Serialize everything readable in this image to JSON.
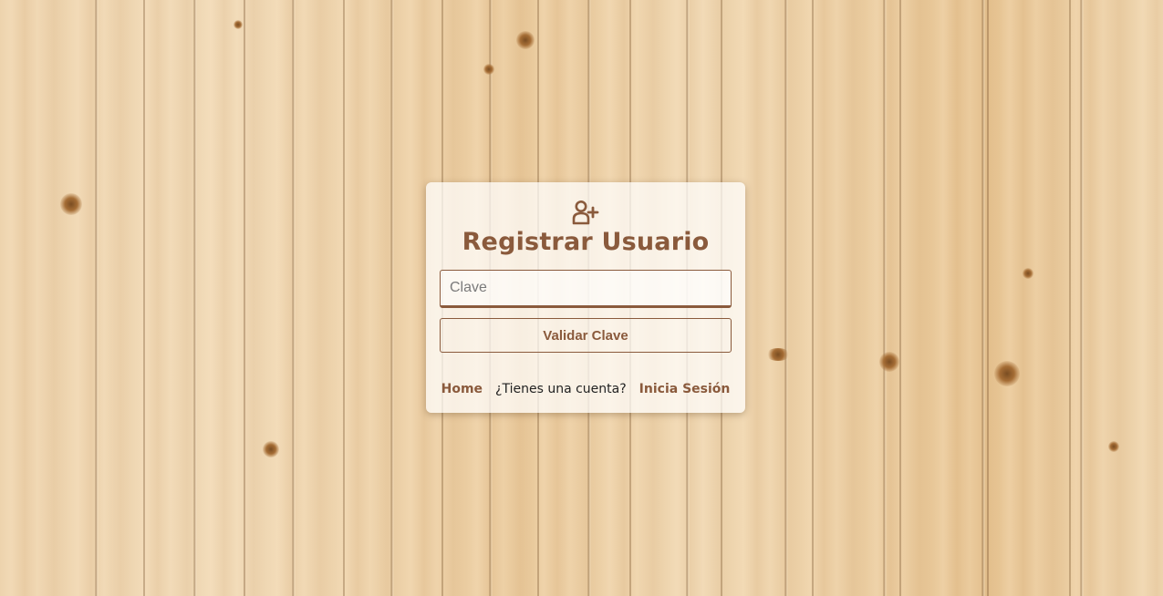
{
  "background": {
    "style": "wood planks"
  },
  "card": {
    "icon": "user-plus-icon",
    "title": "Registrar Usuario",
    "password_field": {
      "value": "",
      "placeholder": "Clave"
    },
    "validate_button_label": "Validar Clave",
    "footer": {
      "home_link": "Home",
      "question": "¿Tienes una cuenta?",
      "login_link": "Inicia Sesión"
    }
  },
  "colors": {
    "accent": "#8a5a3c",
    "card_background": "rgba(255,255,255,0.72)"
  }
}
